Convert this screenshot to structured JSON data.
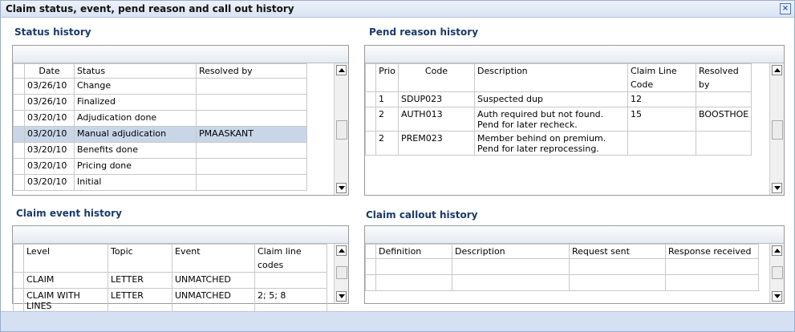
{
  "window": {
    "title": "Claim status, event, pend reason and call out history"
  },
  "status_history": {
    "title": "Status history",
    "columns": [
      "Date",
      "Status",
      "Resolved by"
    ],
    "rows": [
      {
        "date": "03/26/10",
        "status": "Change",
        "resolved_by": ""
      },
      {
        "date": "03/26/10",
        "status": "Finalized",
        "resolved_by": ""
      },
      {
        "date": "03/20/10",
        "status": "Adjudication done",
        "resolved_by": ""
      },
      {
        "date": "03/20/10",
        "status": "Manual adjudication",
        "resolved_by": "PMAASKANT"
      },
      {
        "date": "03/20/10",
        "status": "Benefits done",
        "resolved_by": ""
      },
      {
        "date": "03/20/10",
        "status": "Pricing done",
        "resolved_by": ""
      },
      {
        "date": "03/20/10",
        "status": "Initial",
        "resolved_by": ""
      }
    ]
  },
  "pend_reason_history": {
    "title": "Pend reason history",
    "columns": [
      "Prio",
      "Code",
      "Description",
      "Claim Line Code",
      "Resolved by"
    ],
    "rows": [
      {
        "prio": "1",
        "code": "SDUP023",
        "description": "Suspected dup",
        "claim_line_code": "12",
        "resolved_by": ""
      },
      {
        "prio": "2",
        "code": "AUTH013",
        "description": "Auth required but not found. Pend for later recheck.",
        "claim_line_code": "15",
        "resolved_by": "BOOSTHOE"
      },
      {
        "prio": "2",
        "code": "PREM023",
        "description": "Member behind on premium. Pend for later reprocessing.",
        "claim_line_code": "",
        "resolved_by": ""
      }
    ]
  },
  "claim_event_history": {
    "title": "Claim event history",
    "columns": [
      "Level",
      "Topic",
      "Event",
      "Claim line codes"
    ],
    "rows": [
      {
        "level": "CLAIM",
        "topic": "LETTER",
        "event": "UNMATCHED",
        "claim_line_codes": ""
      },
      {
        "level": "CLAIM WITH LINES",
        "topic": "LETTER",
        "event": "UNMATCHED",
        "claim_line_codes": "2; 5; 8"
      }
    ]
  },
  "claim_callout_history": {
    "title": "Claim callout history",
    "columns": [
      "Definition",
      "Description",
      "Request sent",
      "Response received"
    ],
    "rows": [
      {
        "definition": "",
        "description": "",
        "request_sent": "",
        "response_received": ""
      },
      {
        "definition": "",
        "description": "",
        "request_sent": "",
        "response_received": ""
      }
    ]
  }
}
